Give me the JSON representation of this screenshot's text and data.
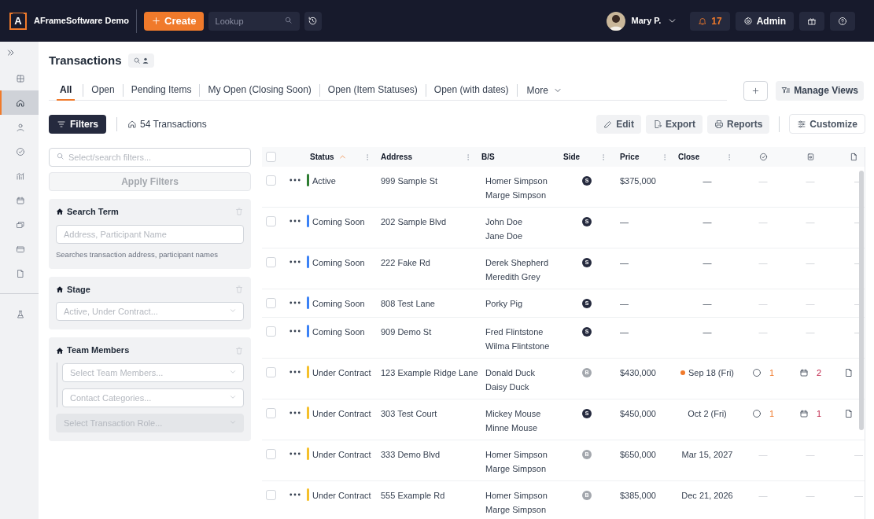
{
  "app": {
    "logo_letter": "A",
    "name": "AFrameSoftware Demo"
  },
  "topbar": {
    "create": "Create",
    "lookup_placeholder": "Lookup",
    "user": "Mary P.",
    "notifications": "17",
    "admin": "Admin"
  },
  "sidebar": {
    "groups": [
      {
        "items": [
          {
            "kind": "grid",
            "selected": false
          },
          {
            "kind": "home",
            "selected": true
          },
          {
            "kind": "person",
            "selected": false
          },
          {
            "kind": "check",
            "selected": false
          },
          {
            "kind": "chart",
            "selected": false
          },
          {
            "kind": "calendar",
            "selected": false
          },
          {
            "kind": "cards",
            "selected": false
          },
          {
            "kind": "card",
            "selected": false
          },
          {
            "kind": "doc",
            "selected": false
          }
        ]
      },
      {
        "items": [
          {
            "kind": "flask",
            "selected": false
          }
        ]
      }
    ]
  },
  "page": {
    "title": "Transactions"
  },
  "tabs": [
    {
      "label": "All",
      "selected": true
    },
    {
      "label": "Open",
      "selected": false
    },
    {
      "label": "Pending Items",
      "selected": false
    },
    {
      "label": "My Open (Closing Soon)",
      "selected": false
    },
    {
      "label": "Open (Item Statuses)",
      "selected": false
    },
    {
      "label": "Open (with dates)",
      "selected": false
    }
  ],
  "more": "More",
  "manage_views": "Manage Views",
  "toolbar": {
    "filters": "Filters",
    "count": "54 Transactions",
    "actions": [
      {
        "kind": "edit",
        "label": "Edit"
      },
      {
        "kind": "export",
        "label": "Export"
      },
      {
        "kind": "print",
        "label": "Reports"
      }
    ],
    "customize": "Customize"
  },
  "filter_panel": {
    "search_placeholder": "Select/search filters...",
    "apply": {
      "label": "Apply Filters",
      "disabled": true
    },
    "groups": [
      {
        "title": "Search Term",
        "fields": [
          {
            "kind": "text",
            "placeholder": "Address, Participant Name",
            "indented": false,
            "disabled": false
          }
        ],
        "hint": "Searches transaction address, participant names"
      },
      {
        "title": "Stage",
        "fields": [
          {
            "kind": "select",
            "placeholder": "Active, Under Contract...",
            "indented": false,
            "disabled": false
          }
        ]
      },
      {
        "title": "Team Members",
        "fields": [
          {
            "kind": "select",
            "placeholder": "Select Team Members...",
            "indented": true,
            "disabled": false
          },
          {
            "kind": "select",
            "placeholder": "Contact Categories...",
            "indented": true,
            "disabled": false
          },
          {
            "kind": "select",
            "placeholder": "Select Transaction Role...",
            "indented": false,
            "disabled": true
          }
        ]
      }
    ]
  },
  "table": {
    "select_all": {
      "checked": false
    },
    "columns": [
      {
        "kind": "text",
        "label": "Status",
        "sorted": true,
        "menu": true
      },
      {
        "kind": "text",
        "label": "Address",
        "sorted": false,
        "menu": true
      },
      {
        "kind": "text",
        "label": "B/S",
        "sorted": false,
        "menu": false
      },
      {
        "kind": "text",
        "label": "Side",
        "sorted": false,
        "menu": true
      },
      {
        "kind": "text",
        "label": "Price",
        "sorted": false,
        "menu": true
      },
      {
        "kind": "text",
        "label": "Close",
        "sorted": false,
        "menu": true
      },
      {
        "kind": "check"
      },
      {
        "kind": "calendar"
      },
      {
        "kind": "doc"
      }
    ],
    "rows": [
      {
        "checked": false,
        "status": "Active",
        "color": "#2e7d32",
        "address": "999 Sample St",
        "people": [
          "Homer Simpson",
          "Marge Simpson"
        ],
        "side": {
          "kind": "seller",
          "letter": "S"
        },
        "price": "$375,000",
        "close": "—",
        "flagged": false,
        "tasks": {
          "kind": "empty",
          "text": "—"
        },
        "events": {
          "kind": "empty",
          "text": "—"
        },
        "docs": {
          "kind": "empty",
          "text": "—"
        }
      },
      {
        "checked": false,
        "status": "Coming Soon",
        "color": "#3b82f6",
        "address": "202 Sample Blvd",
        "people": [
          "John Doe",
          "Jane Doe"
        ],
        "side": {
          "kind": "seller",
          "letter": "S"
        },
        "price": "—",
        "close": "—",
        "flagged": false,
        "tasks": {
          "kind": "empty",
          "text": "—"
        },
        "events": {
          "kind": "empty",
          "text": "—"
        },
        "docs": {
          "kind": "empty",
          "text": "—"
        }
      },
      {
        "checked": false,
        "status": "Coming Soon",
        "color": "#3b82f6",
        "address": "222 Fake Rd",
        "people": [
          "Derek Shepherd",
          "Meredith Grey"
        ],
        "side": {
          "kind": "seller",
          "letter": "S"
        },
        "price": "—",
        "close": "—",
        "flagged": false,
        "tasks": {
          "kind": "empty",
          "text": "—"
        },
        "events": {
          "kind": "empty",
          "text": "—"
        },
        "docs": {
          "kind": "empty",
          "text": "—"
        }
      },
      {
        "checked": false,
        "status": "Coming Soon",
        "color": "#3b82f6",
        "address": "808 Test Lane",
        "people": [
          "Porky Pig"
        ],
        "side": {
          "kind": "seller",
          "letter": "S"
        },
        "price": "—",
        "close": "—",
        "flagged": false,
        "tasks": {
          "kind": "empty",
          "text": "—"
        },
        "events": {
          "kind": "empty",
          "text": "—"
        },
        "docs": {
          "kind": "empty",
          "text": "—"
        }
      },
      {
        "checked": false,
        "status": "Coming Soon",
        "color": "#3b82f6",
        "address": "909 Demo St",
        "people": [
          "Fred Flintstone",
          "Wilma Flintstone"
        ],
        "side": {
          "kind": "seller",
          "letter": "S"
        },
        "price": "—",
        "close": "—",
        "flagged": false,
        "tasks": {
          "kind": "empty",
          "text": "—"
        },
        "events": {
          "kind": "empty",
          "text": "—"
        },
        "docs": {
          "kind": "empty",
          "text": "—"
        }
      },
      {
        "checked": false,
        "status": "Under Contract",
        "color": "#f5c02b",
        "address": "123 Example Ridge Lane",
        "people": [
          "Donald Duck",
          "Daisy Duck"
        ],
        "side": {
          "kind": "buyer",
          "letter": "B"
        },
        "price": "$430,000",
        "close": "Sep 18 (Fri)",
        "flagged": true,
        "tasks": {
          "kind": "count",
          "text": "1"
        },
        "events": {
          "kind": "count",
          "text": "2"
        },
        "docs": {
          "kind": "icon"
        }
      },
      {
        "checked": false,
        "status": "Under Contract",
        "color": "#f5c02b",
        "address": "303 Test Court",
        "people": [
          "Mickey Mouse",
          "Minne Mouse"
        ],
        "side": {
          "kind": "seller",
          "letter": "S"
        },
        "price": "$450,000",
        "close": "Oct 2 (Fri)",
        "flagged": false,
        "tasks": {
          "kind": "count",
          "text": "1"
        },
        "events": {
          "kind": "count",
          "text": "1"
        },
        "docs": {
          "kind": "icon"
        }
      },
      {
        "checked": false,
        "status": "Under Contract",
        "color": "#f5c02b",
        "address": "333 Demo Blvd",
        "people": [
          "Homer Simpson",
          "Marge Simpson"
        ],
        "side": {
          "kind": "buyer",
          "letter": "B"
        },
        "price": "$650,000",
        "close": "Mar 15, 2027",
        "flagged": false,
        "tasks": {
          "kind": "empty",
          "text": "—"
        },
        "events": {
          "kind": "empty",
          "text": "—"
        },
        "docs": {
          "kind": "empty",
          "text": "—"
        }
      },
      {
        "checked": false,
        "status": "Under Contract",
        "color": "#f5c02b",
        "address": "555 Example Rd",
        "people": [
          "Homer Simpson",
          "Marge Simpson"
        ],
        "side": {
          "kind": "buyer",
          "letter": "B"
        },
        "price": "$385,000",
        "close": "Dec 21, 2026",
        "flagged": false,
        "tasks": {
          "kind": "empty",
          "text": "—"
        },
        "events": {
          "kind": "empty",
          "text": "—"
        },
        "docs": {
          "kind": "empty",
          "text": "—"
        }
      }
    ]
  }
}
